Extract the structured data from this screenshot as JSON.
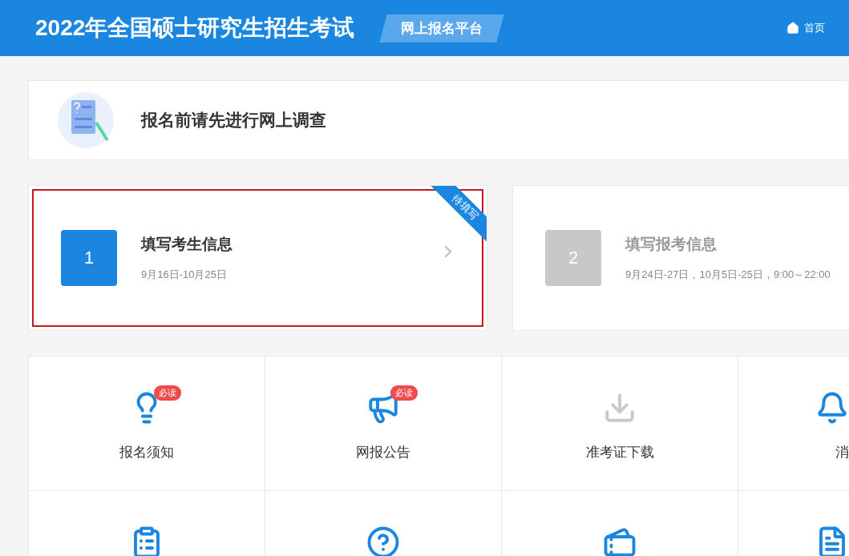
{
  "header": {
    "title": "2022年全国硕士研究生招生考试",
    "tag": "网上报名平台",
    "nav": [
      {
        "label": "首页"
      }
    ]
  },
  "survey": {
    "text": "报名前请先进行网上调查"
  },
  "steps": [
    {
      "number": "1",
      "title": "填写考生信息",
      "dates": "9月16日-10月25日",
      "active": true,
      "highlighted": true,
      "ribbon": "待填写"
    },
    {
      "number": "2",
      "title": "填写报考信息",
      "dates": "9月24日-27日，10月5日-25日，9:00～22:00",
      "active": false,
      "highlighted": false
    }
  ],
  "tiles": [
    {
      "kind": "bulb",
      "label": "报名须知",
      "badge": "必读",
      "disabled": false
    },
    {
      "kind": "speaker",
      "label": "网报公告",
      "badge": "必读",
      "disabled": false
    },
    {
      "kind": "download",
      "label": "准考证下载",
      "disabled": true
    },
    {
      "kind": "bell",
      "label": "消",
      "disabled": false
    },
    {
      "kind": "clipboard",
      "disabled": false
    },
    {
      "kind": "question",
      "disabled": false
    },
    {
      "kind": "tickets",
      "disabled": false
    },
    {
      "kind": "document",
      "disabled": false
    }
  ]
}
